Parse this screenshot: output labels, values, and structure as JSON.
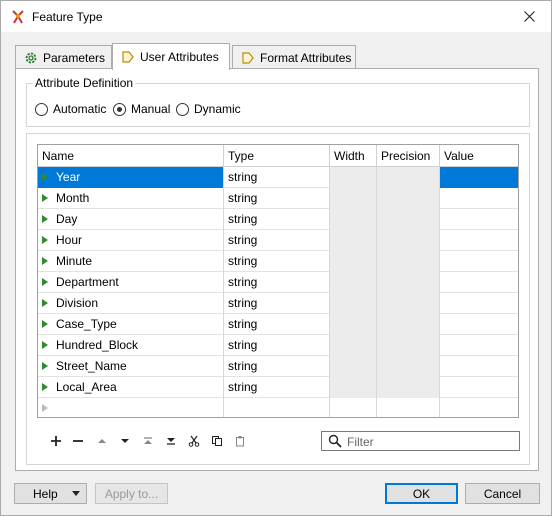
{
  "window": {
    "title": "Feature Type"
  },
  "tabs": [
    {
      "label": "Parameters",
      "icon": "gear-icon"
    },
    {
      "label": "User Attributes",
      "icon": "arrow-tag-icon"
    },
    {
      "label": "Format Attributes",
      "icon": "arrow-tag-icon"
    }
  ],
  "attribute_definition": {
    "label": "Attribute Definition",
    "options": [
      "Automatic",
      "Manual",
      "Dynamic"
    ],
    "selected": "Manual"
  },
  "table": {
    "columns": [
      "Name",
      "Type",
      "Width",
      "Precision",
      "Value"
    ],
    "rows": [
      {
        "name": "Year",
        "type": "string"
      },
      {
        "name": "Month",
        "type": "string"
      },
      {
        "name": "Day",
        "type": "string"
      },
      {
        "name": "Hour",
        "type": "string"
      },
      {
        "name": "Minute",
        "type": "string"
      },
      {
        "name": "Department",
        "type": "string"
      },
      {
        "name": "Division",
        "type": "string"
      },
      {
        "name": "Case_Type",
        "type": "string"
      },
      {
        "name": "Hundred_Block",
        "type": "string"
      },
      {
        "name": "Street_Name",
        "type": "string"
      },
      {
        "name": "Local_Area",
        "type": "string"
      }
    ],
    "selected_row": "Year"
  },
  "toolbar": {
    "icons": [
      "add-icon",
      "remove-icon",
      "move-up-icon",
      "move-down-icon",
      "move-top-icon",
      "move-bottom-icon",
      "cut-icon",
      "copy-icon",
      "paste-icon"
    ],
    "filter_placeholder": "Filter"
  },
  "footer": {
    "help_label": "Help",
    "apply_label": "Apply to...",
    "ok_label": "OK",
    "cancel_label": "Cancel"
  }
}
